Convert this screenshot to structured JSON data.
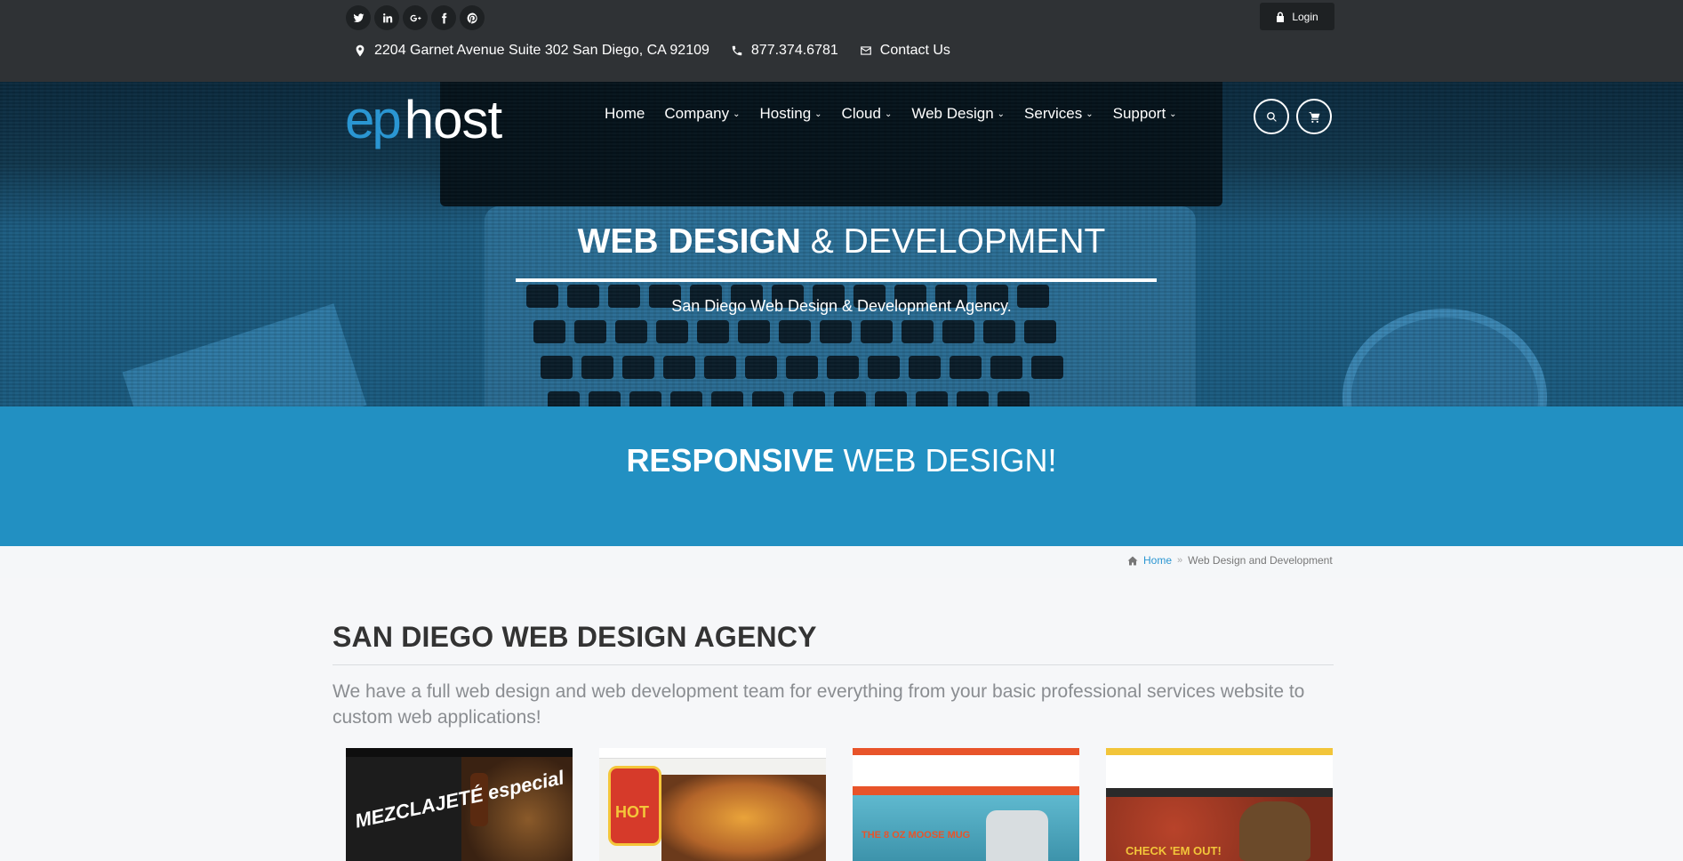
{
  "topbar": {
    "social": [
      "twitter",
      "linkedin",
      "google-plus",
      "facebook",
      "pinterest"
    ],
    "address": "2204 Garnet Avenue Suite 302 San Diego, CA 92109",
    "phone": "877.374.6781",
    "contact": "Contact Us",
    "login": "Login"
  },
  "logo": {
    "part1": "ep",
    "part2": "host"
  },
  "nav": {
    "items": [
      {
        "label": "Home",
        "dropdown": false
      },
      {
        "label": "Company",
        "dropdown": true
      },
      {
        "label": "Hosting",
        "dropdown": true
      },
      {
        "label": "Cloud",
        "dropdown": true
      },
      {
        "label": "Web Design",
        "dropdown": true
      },
      {
        "label": "Services",
        "dropdown": true
      },
      {
        "label": "Support",
        "dropdown": true
      }
    ]
  },
  "hero": {
    "title_bold": "WEB DESIGN",
    "title_rest": " & DEVELOPMENT",
    "subtitle": "San Diego Web Design & Development Agency."
  },
  "band": {
    "title_bold": "RESPONSIVE",
    "title_rest": " WEB DESIGN!"
  },
  "breadcrumb": {
    "home": "Home",
    "current": "Web Design and Development"
  },
  "section": {
    "title": "SAN DIEGO WEB DESIGN AGENCY",
    "text": "We have a full web design and web development team for everything from your basic professional services website to custom web applications!"
  },
  "portfolio": [
    {
      "caption": "MEZCLAJETÉ especial"
    },
    {
      "caption": "HOT"
    },
    {
      "caption": "THE 8 OZ MOOSE MUG"
    },
    {
      "caption": "CHECK 'EM OUT!"
    }
  ],
  "colors": {
    "topbar": "#2f3235",
    "accent": "#2290c2",
    "logo_blue": "#2a96d2"
  }
}
